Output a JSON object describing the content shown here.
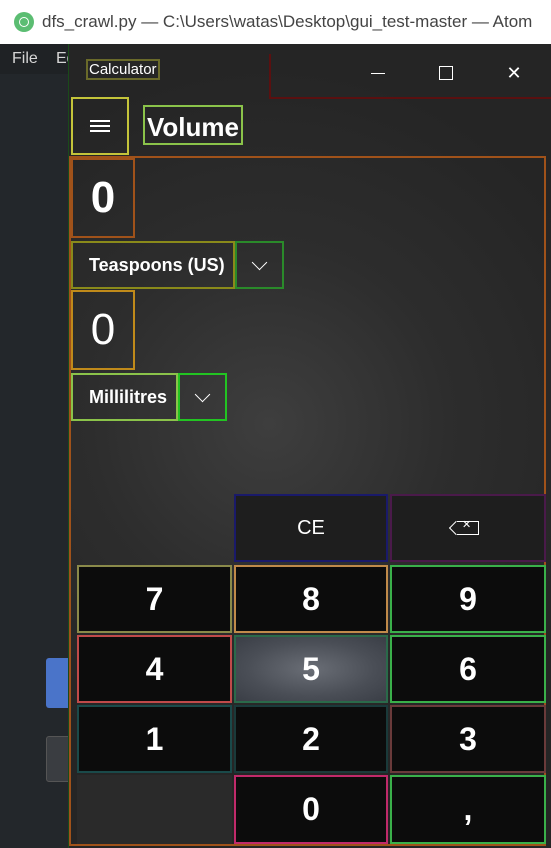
{
  "atom": {
    "title": "dfs_crawl.py — C:\\Users\\watas\\Desktop\\gui_test-master — Atom",
    "menu": [
      "File",
      "Ed"
    ]
  },
  "calculator": {
    "window_title": "Calculator",
    "mode": "Volume",
    "from_value": "0",
    "from_unit": "Teaspoons (US)",
    "to_value": "0",
    "to_unit": "Millilitres",
    "keys": {
      "ce": "CE",
      "seven": "7",
      "eight": "8",
      "nine": "9",
      "four": "4",
      "five": "5",
      "six": "6",
      "one": "1",
      "two": "2",
      "three": "3",
      "zero": "0",
      "decimal": ","
    }
  }
}
